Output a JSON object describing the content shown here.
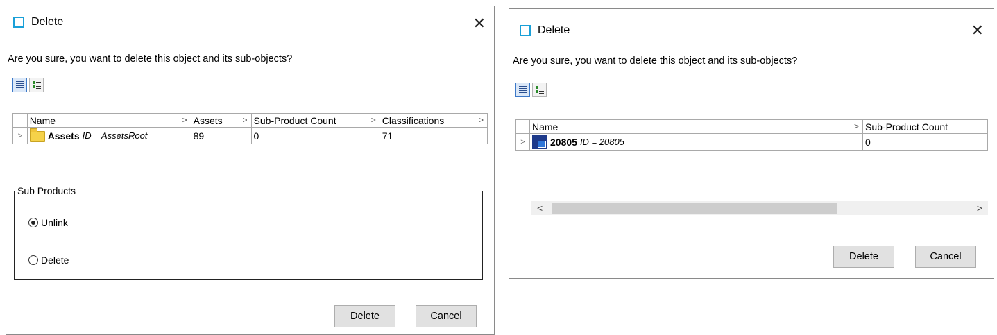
{
  "dialog1": {
    "title": "Delete",
    "prompt": "Are you sure, you want to delete this object and its sub-objects?",
    "columns": [
      "Name",
      "Assets",
      "Sub-Product Count",
      "Classifications"
    ],
    "row": {
      "name": "Assets",
      "id_text": "ID = AssetsRoot",
      "assets": "89",
      "sub_product_count": "0",
      "classifications": "71",
      "icon": "folder-icon"
    },
    "group_label": "Sub Products",
    "radio_unlink": "Unlink",
    "radio_delete": "Delete",
    "selected_option": "Unlink",
    "delete_label": "Delete",
    "cancel_label": "Cancel"
  },
  "dialog2": {
    "title": "Delete",
    "prompt": "Are you sure, you want to delete this object and its sub-objects?",
    "columns": [
      "Name",
      "Sub-Product Count"
    ],
    "row": {
      "name": "20805",
      "id_text": "ID = 20805",
      "sub_product_count": "0",
      "icon": "product-icon"
    },
    "scroll_left": "<",
    "scroll_right": ">",
    "delete_label": "Delete",
    "cancel_label": "Cancel"
  },
  "icons": {
    "close": "✕",
    "row_expand": ">",
    "column_chevron": ">"
  },
  "colors": {
    "window_icon": "#1aa0d8",
    "active_view_border": "#3c78c8",
    "button_bg": "#e1e1e1"
  }
}
